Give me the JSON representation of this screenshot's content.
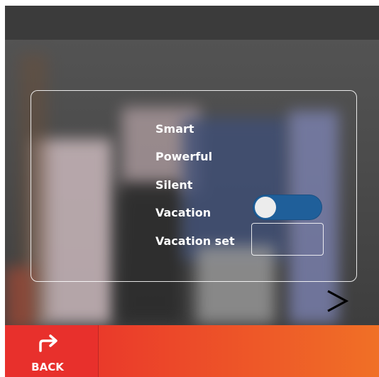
{
  "settings": {
    "items": [
      {
        "label": "Smart"
      },
      {
        "label": "Powerful"
      },
      {
        "label": "Silent"
      },
      {
        "label": "Vacation"
      },
      {
        "label": "Vacation set"
      }
    ],
    "vacation_toggle": {
      "on": true,
      "color": "#1f5f9a"
    },
    "vacation_set_value": ""
  },
  "navigation": {
    "next_icon": "chevron-right-icon",
    "back_icon": "share-arrow-icon",
    "back_label": "BACK"
  },
  "colors": {
    "bottom_bar_start": "#e8302c",
    "bottom_bar_end": "#f07026",
    "toggle_on": "#1f5f9a"
  }
}
